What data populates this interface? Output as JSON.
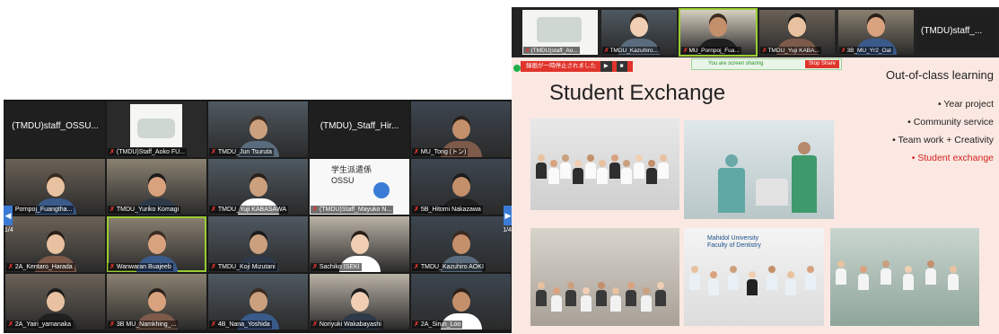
{
  "gallery": {
    "page_left": "1/4",
    "page_right": "1/4",
    "tiles": [
      {
        "label": "",
        "name": "(TMDU)staff_OSSU...",
        "kind": "text"
      },
      {
        "label": "(TMDU)Staff_Aoko FU...",
        "kind": "poster"
      },
      {
        "label": "TMDU_Jun Tsuruta",
        "kind": "person"
      },
      {
        "label": "",
        "name": "(TMDU)_Staff_Hir...",
        "kind": "text"
      },
      {
        "label": "MU_Tong (トン)",
        "kind": "person"
      },
      {
        "label": "Pornpoj_Fuangtha...",
        "kind": "person"
      },
      {
        "label": "TMDU_Yuriko Komagi",
        "kind": "person"
      },
      {
        "label": "TMDU_Yuji KABASAWA",
        "kind": "person"
      },
      {
        "label": "(TMDU)Staff_Mayuko N...",
        "kind": "poster2",
        "sign_line1": "学生派遣係",
        "sign_line2": "OSSU"
      },
      {
        "label": "5B_Hitomi Nakazawa",
        "kind": "person"
      },
      {
        "label": "2A_Kentaro_Harada",
        "kind": "person"
      },
      {
        "label": "Wanwaran Buajeeb",
        "kind": "person"
      },
      {
        "label": "TMDU_Koji Mizutani",
        "kind": "person"
      },
      {
        "label": "Sachiko ISEKI",
        "kind": "person"
      },
      {
        "label": "TMDU_Kazuhiro AOKI",
        "kind": "person"
      },
      {
        "label": "2A_Yairi_yamanaka",
        "kind": "person"
      },
      {
        "label": "3B MU_Namkhing_...",
        "kind": "person"
      },
      {
        "label": "4B_Nana_Yoshida",
        "kind": "person"
      },
      {
        "label": "Noriyuki Wakabayashi",
        "kind": "person"
      },
      {
        "label": "2A_Sirun_Loo",
        "kind": "person"
      }
    ]
  },
  "strip": {
    "tiles": [
      {
        "label": "(TMDU)staff_Ao...",
        "kind": "slide"
      },
      {
        "label": "TMDU_Kazuhiro...",
        "kind": "person"
      },
      {
        "label": "MU_Pornpoj_Fua...",
        "kind": "person"
      },
      {
        "label": "TMDU_Yuji KABA...",
        "kind": "person"
      },
      {
        "label": "3B_MU_Yr2_Oat",
        "kind": "person"
      },
      {
        "label": "",
        "name": "(TMDU)staff_...",
        "kind": "text"
      }
    ]
  },
  "share": {
    "status": "You are screen sharing",
    "stop": "Stop Share",
    "recording": "録画が一時停止されました"
  },
  "slide": {
    "title": "Student Exchange",
    "ocl_title": "Out-of-class learning",
    "bullets": [
      {
        "text": "• Year project",
        "highlight": false
      },
      {
        "text": "• Community service",
        "highlight": false
      },
      {
        "text": "• Team work + Creativity",
        "highlight": false
      },
      {
        "text": "• Student exchange",
        "highlight": true
      }
    ],
    "photo_caption": "Mahidol University\nFaculty of Dentistry"
  },
  "colors": {
    "mic_muted": "#e0342c",
    "active_speaker": "#9acd32",
    "slide_bg": "#fbe8e2",
    "highlight": "#d42020"
  }
}
